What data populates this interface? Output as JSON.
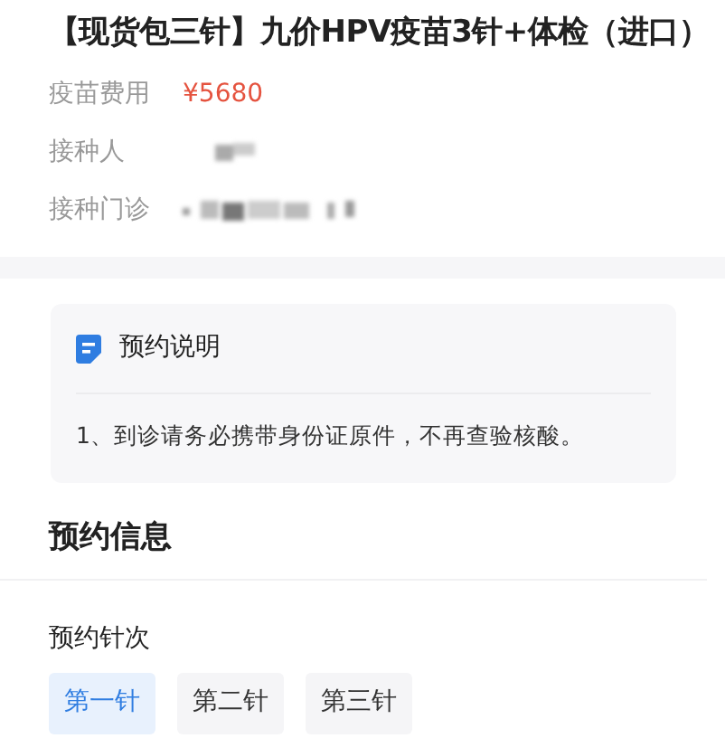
{
  "title": "【现货包三针】九价HPV疫苗3针+体检（进口）",
  "details": [
    {
      "label": "疫苗费用",
      "value": "¥5680",
      "kind": "price"
    },
    {
      "label": "接种人",
      "kind": "blurred"
    },
    {
      "label": "接种门诊",
      "kind": "blurred"
    }
  ],
  "notice": {
    "title": "预约说明",
    "text": "1、到诊请务必携带身份证原件，不再查验核酸。"
  },
  "section_title": "预约信息",
  "dose_label": "预约针次",
  "doses": [
    {
      "label": "第一针",
      "selected": true
    },
    {
      "label": "第二针",
      "selected": false
    },
    {
      "label": "第三针",
      "selected": false
    }
  ]
}
